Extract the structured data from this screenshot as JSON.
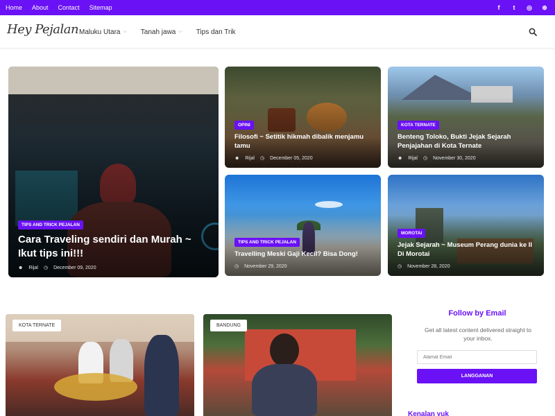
{
  "topbar": {
    "links": [
      "Home",
      "About",
      "Contact",
      "Sitemap"
    ],
    "social_icons": [
      "facebook-icon",
      "twitter-icon",
      "instagram-icon",
      "web-icon"
    ],
    "social_glyphs": [
      "f",
      "t",
      "◎",
      "⊕"
    ],
    "color": "#6a11f5"
  },
  "header": {
    "logo": "Hey Pejalan",
    "nav": [
      {
        "label": "Maluku Utara",
        "dropdown": true
      },
      {
        "label": "Tanah jawa",
        "dropdown": true
      },
      {
        "label": "Tips dan Trik",
        "dropdown": false
      }
    ]
  },
  "featured": [
    {
      "category": "TIPS AND TRICK PEJALAN",
      "title": "Cara Traveling sendiri dan Murah ~ Ikut tips ini!!!",
      "author": "Rijal",
      "date": "December 09, 2020"
    },
    {
      "category": "OPINI",
      "title": "Filosofi ~ Setitik hikmah dibalik menjamu tamu",
      "author": "Rijal",
      "date": "December 05, 2020"
    },
    {
      "category": "KOTA TERNATE",
      "title": "Benteng Toloko, Bukti Jejak Sejarah Penjajahan di Kota Ternate",
      "author": "Rijal",
      "date": "November 30, 2020"
    },
    {
      "category": "TIPS AND TRICK PEJALAN",
      "title": "Travelling Meski Gaji Kecil? Bisa Dong!",
      "date": "November 29, 2020"
    },
    {
      "category": "MOROTAI",
      "title": "Jejak Sejarah ~ Museum Perang dunia ke II Di Morotai",
      "date": "November 28, 2020"
    }
  ],
  "posts": [
    {
      "category": "KOTA TERNATE"
    },
    {
      "category": "BANDUNG"
    }
  ],
  "sidebar": {
    "follow_title": "Follow by Email",
    "follow_desc": "Get all latest content delivered straight to your inbox.",
    "email_placeholder": "Alamat Email",
    "subscribe_label": "LANGGANAN",
    "next_heading": "Kenalan yuk"
  }
}
